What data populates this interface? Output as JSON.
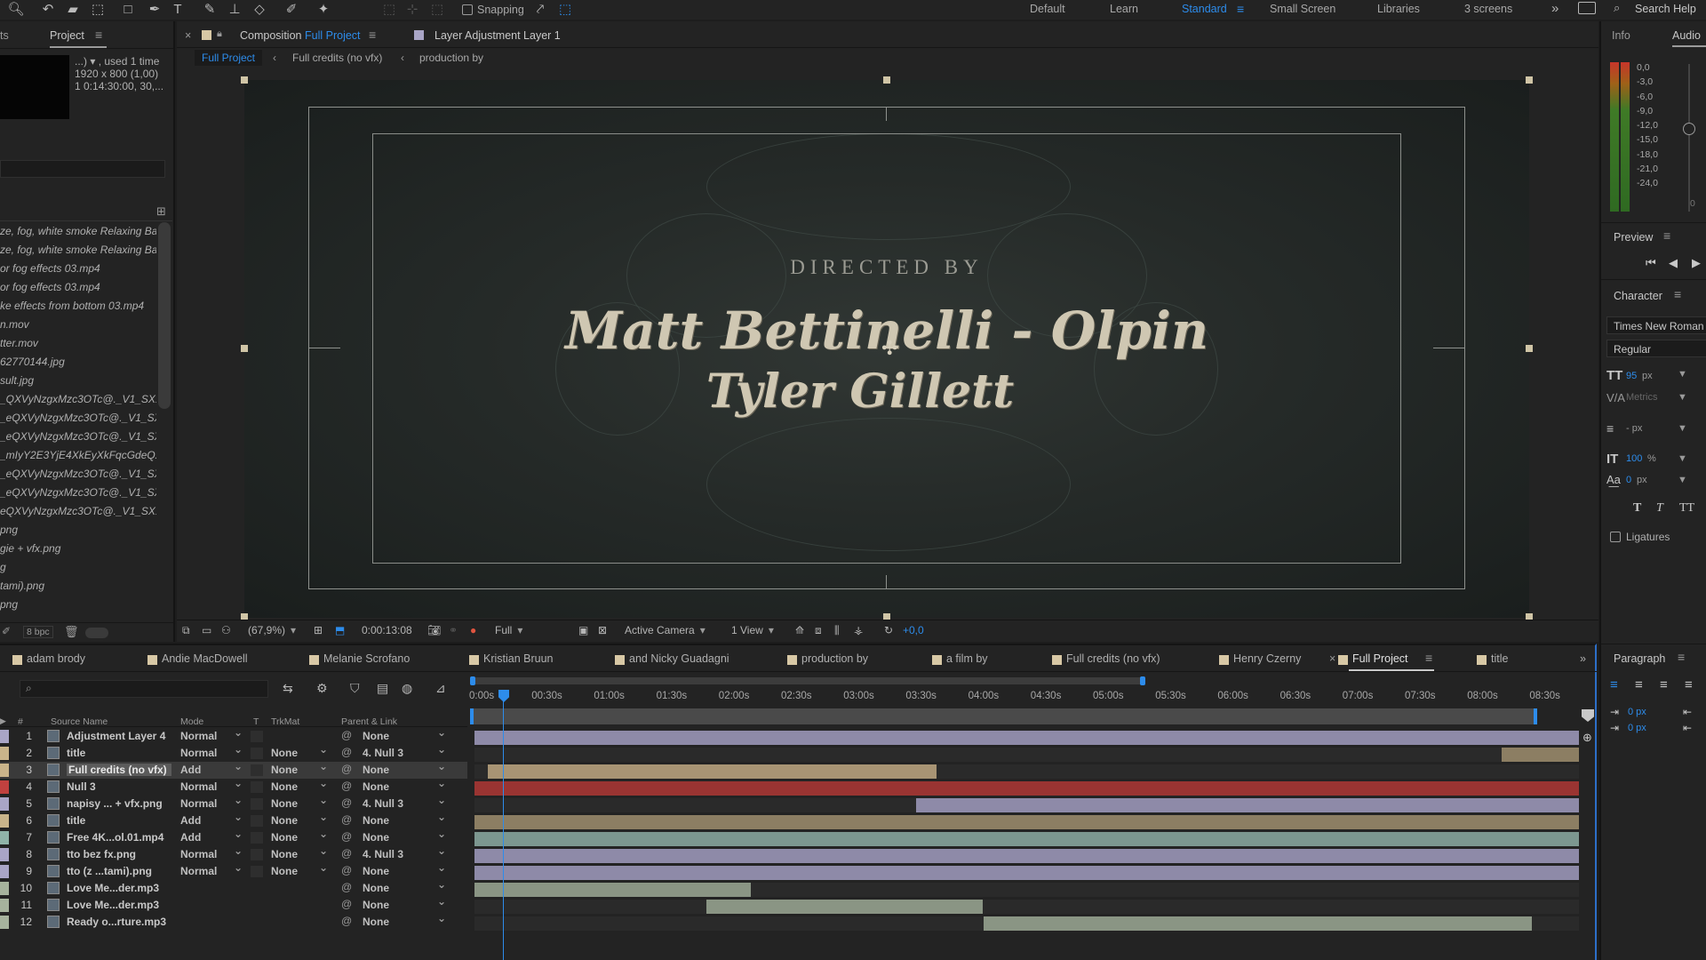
{
  "toolbar": {
    "snapping_label": "Snapping",
    "workspaces": [
      {
        "label": "Default",
        "active": false
      },
      {
        "label": "Learn",
        "active": false
      },
      {
        "label": "Standard",
        "active": true
      },
      {
        "label": "Small Screen",
        "active": false
      },
      {
        "label": "Libraries",
        "active": false
      },
      {
        "label": "3 screens",
        "active": false
      }
    ],
    "more": "»",
    "search_help": "Search Help"
  },
  "project": {
    "tab_prev": "ts",
    "tab": "Project",
    "info_line1": "...) ▾ , used 1 time",
    "info_line2": "1920 x 800 (1,00)",
    "info_line3": "1 0:14:30:00, 30,...",
    "files": [
      "ze, fog, white smoke   Relaxing Ba",
      "ze, fog, white smoke   Relaxing Ba",
      "or fog effects 03.mp4",
      "or fog effects 03.mp4",
      "ke effects from bottom 03.mp4",
      "n.mov",
      "tter.mov",
      "62770144.jpg",
      "sult.jpg",
      "_QXVyNzgxMzc3OTc@._V1_SX1",
      "_eQXVyNzgxMzc3OTc@._V1_SX",
      "_eQXVyNzgxMzc3OTc@._V1_SX1",
      "_mIyY2E3YjE4XkEyXkFqcGdeQX",
      "_eQXVyNzgxMzc3OTc@._V1_SX1",
      "_eQXVyNzgxMzc3OTc@._V1_SX",
      "eQXVyNzgxMzc3OTc@._V1_SX1",
      "png",
      "gie + vfx.png",
      "g",
      "tami).png",
      "png"
    ],
    "bpc": "8 bpc"
  },
  "composition": {
    "close": "×",
    "prefix": "Composition",
    "name": "Full Project",
    "layer_tab": "Layer  Adjustment Layer 1",
    "breadcrumbs": [
      "Full Project",
      "Full credits (no vfx)",
      "production by"
    ],
    "credit_header": "DIRECTED BY",
    "credit_names": [
      "Matt Bettinelli - Olpin",
      "Tyler Gillett"
    ],
    "zoom": "(67,9%)",
    "timecode": "0:00:13:08",
    "resolution": "Full",
    "camera": "Active Camera",
    "views": "1 View",
    "exposure": "+0,0"
  },
  "info_panel": {
    "tabs": [
      "Info",
      "Audio"
    ],
    "db_values": [
      "0,0",
      "-3,0",
      "-6,0",
      "-9,0",
      "-12,0",
      "-15,0",
      "-18,0",
      "-21,0",
      "-24,0"
    ],
    "audio_scale_value": "0"
  },
  "preview": {
    "title": "Preview"
  },
  "character": {
    "title": "Character",
    "font": "Times New Roman",
    "style": "Regular",
    "size": "95",
    "size_unit": "px",
    "kerning": "Metrics",
    "leading": "- px",
    "vscale": "100",
    "vscale_unit": "%",
    "baseline": "0",
    "baseline_unit": "px",
    "ligatures": "Ligatures"
  },
  "paragraph": {
    "title": "Paragraph",
    "indent1": "0 px",
    "indent2": "0 px"
  },
  "timeline": {
    "comp_tabs": [
      {
        "label": "adam brody",
        "color": "#d8c8a5"
      },
      {
        "label": "Andie MacDowell",
        "color": "#d8c8a5"
      },
      {
        "label": "Melanie Scrofano",
        "color": "#d8c8a5"
      },
      {
        "label": "Kristian Bruun",
        "color": "#d8c8a5"
      },
      {
        "label": "and Nicky Guadagni",
        "color": "#d8c8a5"
      },
      {
        "label": "production by",
        "color": "#d8c8a5"
      },
      {
        "label": "a film by",
        "color": "#d8c8a5"
      },
      {
        "label": "Full credits (no vfx)",
        "color": "#d8c8a5"
      },
      {
        "label": "Henry Czerny",
        "color": "#d8c8a5"
      },
      {
        "label": "Full Project",
        "color": "#d8c8a5",
        "active": true
      },
      {
        "label": "title",
        "color": "#d8c8a5"
      }
    ],
    "search_placeholder": "",
    "headers": {
      "num": "#",
      "source": "Source Name",
      "mode": "Mode",
      "t": "T",
      "trkmat": "TrkMat",
      "parent": "Parent & Link"
    },
    "ruler": [
      "0:00s",
      "00:30s",
      "01:00s",
      "01:30s",
      "02:00s",
      "02:30s",
      "03:00s",
      "03:30s",
      "04:00s",
      "04:30s",
      "05:00s",
      "05:30s",
      "06:00s",
      "06:30s",
      "07:00s",
      "07:30s",
      "08:00s",
      "08:30s"
    ],
    "layers": [
      {
        "num": "1",
        "name": "Adjustment Layer 4",
        "mode": "Normal",
        "trkmat": "",
        "parent": "None",
        "label_color": "#a9a5c6",
        "bar_color": "#8e8aa8",
        "bar_start": 0.0,
        "bar_end": 1.0,
        "selected": false
      },
      {
        "num": "2",
        "name": "title",
        "mode": "Normal",
        "trkmat": "None",
        "parent": "4. Null 3",
        "label_color": "#c9b48a",
        "bar_color": "#8c7e63",
        "bar_start": 0.93,
        "bar_end": 1.0,
        "selected": false
      },
      {
        "num": "3",
        "name": "Full credits (no vfx)",
        "mode": "Add",
        "trkmat": "None",
        "parent": "None",
        "label_color": "#c9b48a",
        "bar_color": "#a89474",
        "bar_start": 0.012,
        "bar_end": 0.418,
        "selected": true
      },
      {
        "num": "4",
        "name": "Null 3",
        "mode": "Normal",
        "trkmat": "None",
        "parent": "None",
        "label_color": "#c0413f",
        "bar_color": "#9a3432",
        "bar_start": 0.0,
        "bar_end": 1.0,
        "selected": false
      },
      {
        "num": "5",
        "name": "napisy ... + vfx.png",
        "mode": "Normal",
        "trkmat": "None",
        "parent": "4. Null 3",
        "label_color": "#a9a5c6",
        "bar_color": "#8e8aa8",
        "bar_start": 0.4,
        "bar_end": 1.0,
        "selected": false
      },
      {
        "num": "6",
        "name": "title",
        "mode": "Add",
        "trkmat": "None",
        "parent": "None",
        "label_color": "#c9b48a",
        "bar_color": "#8c7e63",
        "bar_start": 0.0,
        "bar_end": 1.0,
        "selected": false
      },
      {
        "num": "7",
        "name": "Free 4K...ol.01.mp4",
        "mode": "Add",
        "trkmat": "None",
        "parent": "None",
        "label_color": "#8fb3a8",
        "bar_color": "#7c9790",
        "bar_start": 0.0,
        "bar_end": 1.0,
        "selected": false
      },
      {
        "num": "8",
        "name": "tto bez fx.png",
        "mode": "Normal",
        "trkmat": "None",
        "parent": "4. Null 3",
        "label_color": "#a9a5c6",
        "bar_color": "#8e8aa8",
        "bar_start": 0.0,
        "bar_end": 1.0,
        "selected": false
      },
      {
        "num": "9",
        "name": "tto (z ...tami).png",
        "mode": "Normal",
        "trkmat": "None",
        "parent": "None",
        "label_color": "#a9a5c6",
        "bar_color": "#8e8aa8",
        "bar_start": 0.0,
        "bar_end": 1.0,
        "selected": false
      },
      {
        "num": "10",
        "name": "Love Me...der.mp3",
        "mode": "",
        "trkmat": "",
        "parent": "None",
        "label_color": "#a6b39d",
        "bar_color": "#8a9584",
        "bar_start": 0.0,
        "bar_end": 0.25,
        "selected": false
      },
      {
        "num": "11",
        "name": "Love Me...der.mp3",
        "mode": "",
        "trkmat": "",
        "parent": "None",
        "label_color": "#a6b39d",
        "bar_color": "#8a9584",
        "bar_start": 0.21,
        "bar_end": 0.46,
        "selected": false
      },
      {
        "num": "12",
        "name": "Ready o...rture.mp3",
        "mode": "",
        "trkmat": "",
        "parent": "None",
        "label_color": "#a6b39d",
        "bar_color": "#8a9584",
        "bar_start": 0.461,
        "bar_end": 0.957,
        "selected": false
      }
    ]
  }
}
